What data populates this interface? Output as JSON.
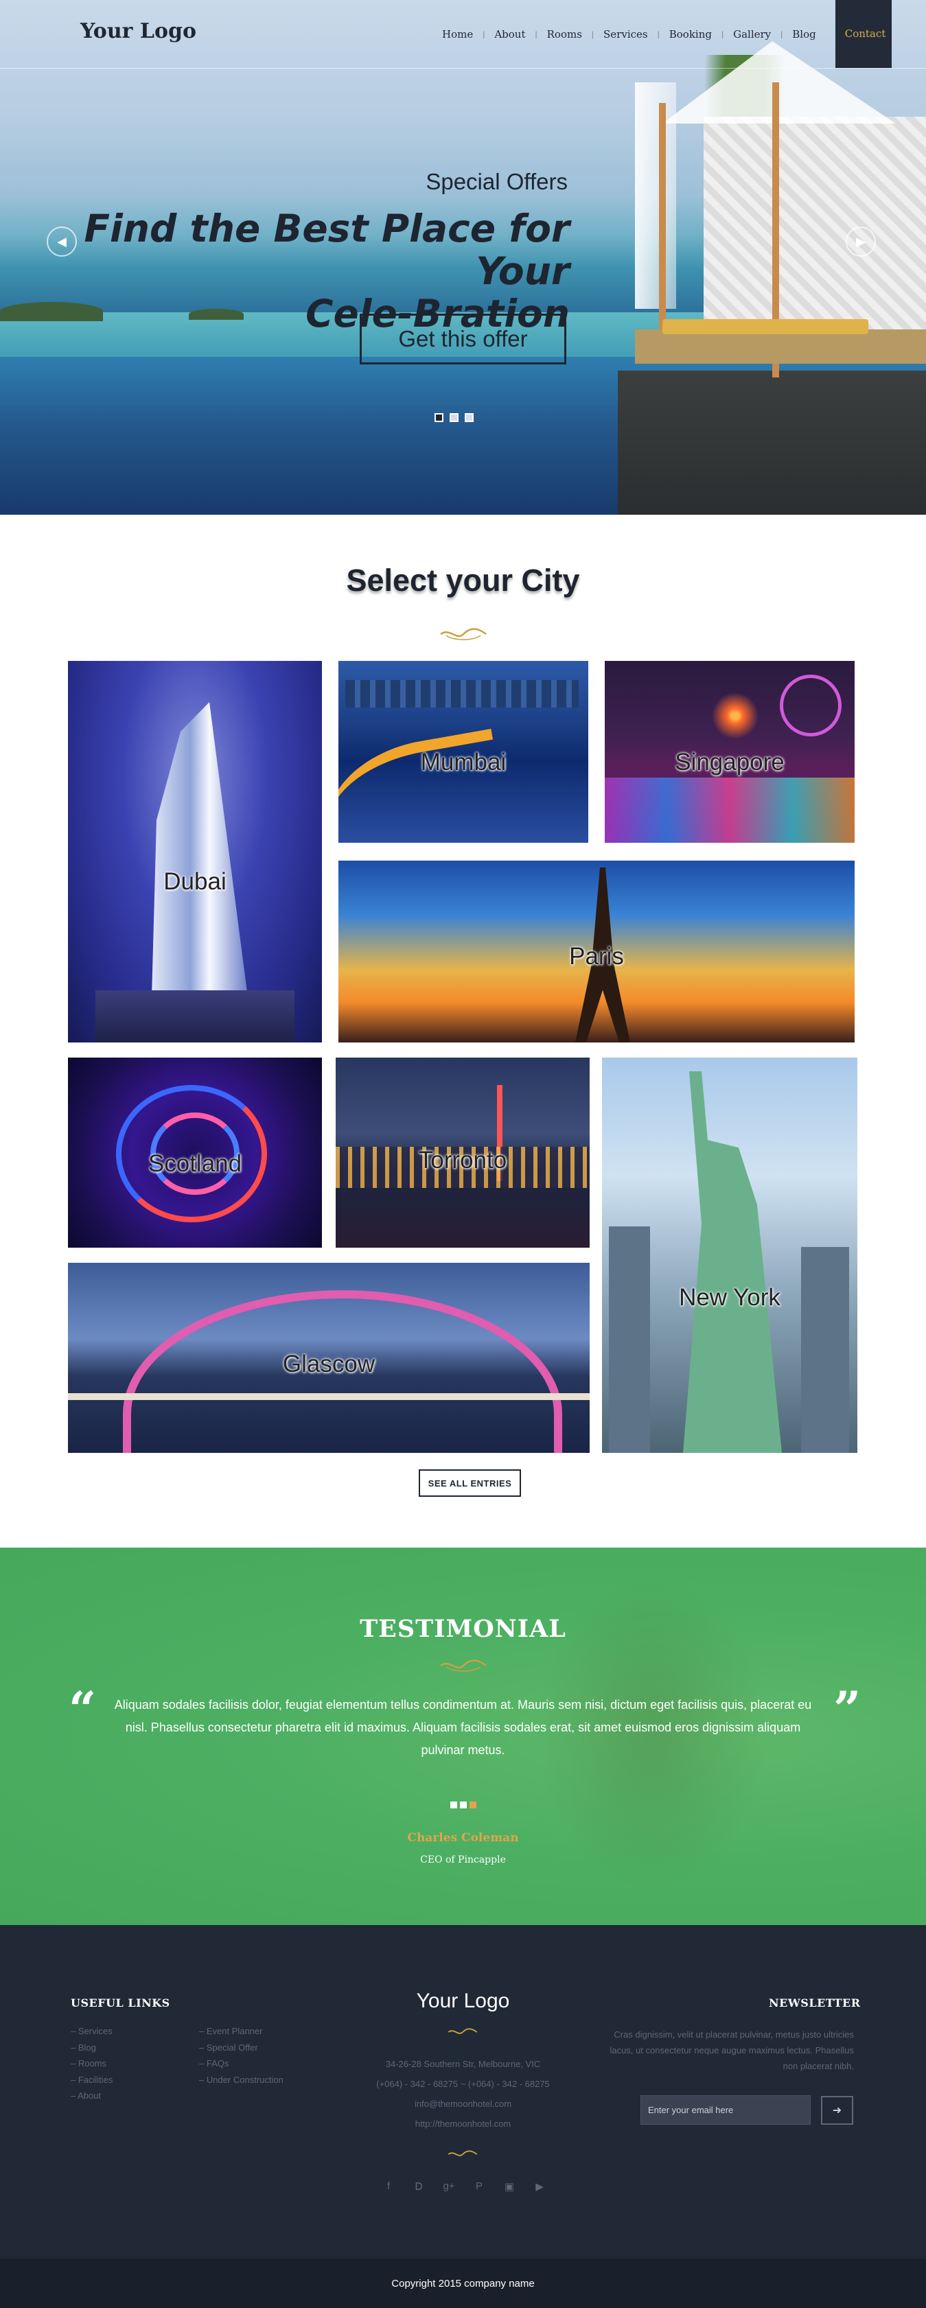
{
  "header": {
    "logo": "Your Logo",
    "nav": [
      "Home",
      "About",
      "Rooms",
      "Services",
      "Booking",
      "Gallery",
      "Blog"
    ],
    "nav_active": "Contact"
  },
  "hero": {
    "subtitle": "Special Offers",
    "title_line1": "Find the Best Place for Your",
    "title_line2": "Cele-Bration",
    "button": "Get this offer",
    "slides": 3,
    "active_slide": 1
  },
  "cities": {
    "title": "Select your City",
    "items": [
      "Dubai",
      "Mumbai",
      "Singapore",
      "Paris",
      "Scotland",
      "Torronto",
      "New York",
      "Glascow"
    ],
    "button": "SEE ALL ENTRIES"
  },
  "testimonial": {
    "title": "TESTIMONIAL",
    "quote": "Aliquam sodales facilisis dolor, feugiat elementum tellus condimentum at. Mauris sem nisi, dictum eget facilisis quis, placerat eu nisl. Phasellus consectetur pharetra elit id maximus. Aliquam facilisis sodales erat, sit amet euismod eros dignissim aliquam pulvinar metus.",
    "author": "Charles Coleman",
    "role": "CEO of Pincapple",
    "accent": "#e3a34c"
  },
  "footer": {
    "links_title": "USEFUL LINKS",
    "links_col1": [
      "Services",
      "Blog",
      "Rooms",
      "Facilities",
      "About"
    ],
    "links_col2": [
      "Event Planner",
      "Special Offer",
      "FAQs",
      "Under Construction"
    ],
    "logo": "Your Logo",
    "address": "34-26-28 Southern Str, Melbourne, VIC",
    "phones": "(+064) - 342 - 68275 ~ (+064) - 342 - 68275",
    "email": "info@themoonhotel.com",
    "website": "http://themoonhotel.com",
    "newsletter_title": "NEWSLETTER",
    "newsletter_text": "Cras dignissim, velit ut placerat pulvinar, metus justo ultricies lacus, ut consectetur neque augue maximus lectus. Phasellus non placerat nibh.",
    "email_placeholder": "Enter your email here",
    "social": [
      "facebook-icon",
      "twitter-icon",
      "google-plus-icon",
      "pinterest-icon",
      "instagram-icon",
      "youtube-icon"
    ],
    "copyright": "Copyright 2015 company name"
  },
  "colors": {
    "dark": "#1e2530",
    "gold": "#d8b04e",
    "green": "#4daf62",
    "footer": "#212836"
  }
}
